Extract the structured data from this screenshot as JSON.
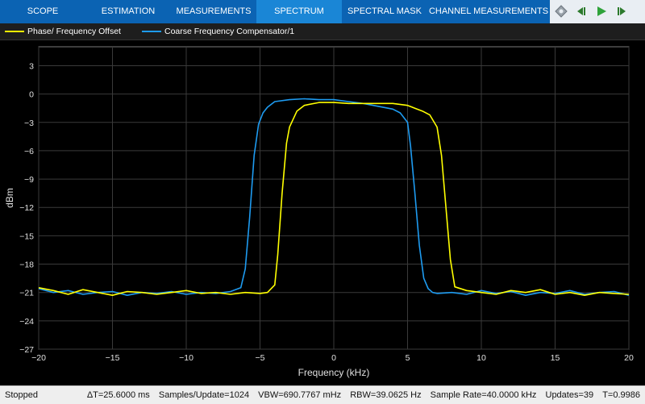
{
  "toolbar": {
    "tabs": [
      {
        "label": "SCOPE",
        "active": false
      },
      {
        "label": "ESTIMATION",
        "active": false
      },
      {
        "label": "MEASUREMENTS",
        "active": false
      },
      {
        "label": "SPECTRUM",
        "active": true
      },
      {
        "label": "SPECTRAL MASK",
        "active": false
      },
      {
        "label": "CHANNEL MEASUREMENTS",
        "active": false
      }
    ],
    "buttons": [
      {
        "icon": "settings-icon"
      },
      {
        "icon": "step-back-icon"
      },
      {
        "icon": "run-icon"
      },
      {
        "icon": "step-forward-icon"
      }
    ],
    "colors": {
      "bar": "#0b63b3",
      "active_tab": "#1a86d6"
    }
  },
  "legend": {
    "items": [
      {
        "label": "Phase/ Frequency Offset",
        "color": "#ffff00"
      },
      {
        "label": "Coarse Frequency Compensator/1",
        "color": "#1e9bf0"
      }
    ]
  },
  "chart_data": {
    "type": "line",
    "xlabel": "Frequency (kHz)",
    "ylabel": "dBm",
    "xlim": [
      -20,
      20
    ],
    "ylim": [
      -27,
      5
    ],
    "xticks": [
      -20,
      -15,
      -10,
      -5,
      0,
      5,
      10,
      15,
      20
    ],
    "yticks": [
      3,
      0,
      -3,
      -6,
      -9,
      -12,
      -15,
      -18,
      -21,
      -24,
      -27
    ],
    "grid": true,
    "series": [
      {
        "name": "Phase/ Frequency Offset",
        "color": "#ffff00",
        "x": [
          -20,
          -19,
          -18,
          -17,
          -16,
          -15,
          -14,
          -13,
          -12,
          -11,
          -10,
          -9,
          -8,
          -7,
          -6,
          -5,
          -4.5,
          -4,
          -3.8,
          -3.5,
          -3.2,
          -3,
          -2.5,
          -2,
          -1,
          0,
          1,
          2,
          3,
          4,
          5,
          5.5,
          6,
          6.5,
          7,
          7.3,
          7.6,
          7.9,
          8.2,
          9,
          10,
          11,
          12,
          13,
          14,
          15,
          16,
          17,
          18,
          19,
          20
        ],
        "y": [
          -20.5,
          -20.8,
          -21.2,
          -20.7,
          -21,
          -21.3,
          -20.9,
          -21,
          -21.2,
          -21,
          -20.8,
          -21.1,
          -21,
          -21.2,
          -21,
          -21.1,
          -21,
          -20.2,
          -17,
          -10.5,
          -5.2,
          -3.5,
          -1.8,
          -1.2,
          -0.9,
          -0.9,
          -1,
          -1,
          -1,
          -1,
          -1.2,
          -1.5,
          -1.8,
          -2.2,
          -3.5,
          -6.5,
          -12,
          -17.5,
          -20.4,
          -20.8,
          -21,
          -21.2,
          -20.8,
          -21,
          -20.7,
          -21.2,
          -21,
          -21.3,
          -21,
          -21.1,
          -21.2
        ]
      },
      {
        "name": "Coarse Frequency Compensator/1",
        "color": "#1e9bf0",
        "x": [
          -20,
          -19,
          -18,
          -17,
          -16,
          -15,
          -14,
          -13,
          -12,
          -11,
          -10,
          -9,
          -8,
          -7,
          -6.3,
          -6,
          -5.7,
          -5.4,
          -5.1,
          -4.8,
          -4.5,
          -4,
          -3,
          -2,
          -1,
          0,
          1,
          2,
          3,
          4,
          4.5,
          5,
          5.2,
          5.5,
          5.8,
          6.1,
          6.4,
          6.7,
          7,
          8,
          9,
          10,
          11,
          12,
          13,
          14,
          15,
          16,
          17,
          18,
          19,
          20
        ],
        "y": [
          -20.6,
          -21,
          -20.8,
          -21.2,
          -21,
          -20.9,
          -21.3,
          -21,
          -21.1,
          -20.9,
          -21.2,
          -21,
          -21.1,
          -20.9,
          -20.5,
          -18.5,
          -13,
          -6.5,
          -3.2,
          -2,
          -1.4,
          -0.8,
          -0.6,
          -0.5,
          -0.6,
          -0.6,
          -0.8,
          -1,
          -1.3,
          -1.6,
          -2,
          -3,
          -5.5,
          -10.5,
          -16,
          -19.5,
          -20.6,
          -21,
          -21.1,
          -21,
          -21.2,
          -20.8,
          -21.1,
          -20.9,
          -21.3,
          -21,
          -21.1,
          -20.8,
          -21.2,
          -21,
          -20.9,
          -21.3
        ]
      }
    ]
  },
  "status": {
    "state": "Stopped",
    "delta_t": "ΔT=25.6000 ms",
    "samples_update": "Samples/Update=1024",
    "vbw": "VBW=690.7767 mHz",
    "rbw": "RBW=39.0625 Hz",
    "sample_rate": "Sample Rate=40.0000 kHz",
    "updates": "Updates=39",
    "t": "T=0.9986"
  }
}
